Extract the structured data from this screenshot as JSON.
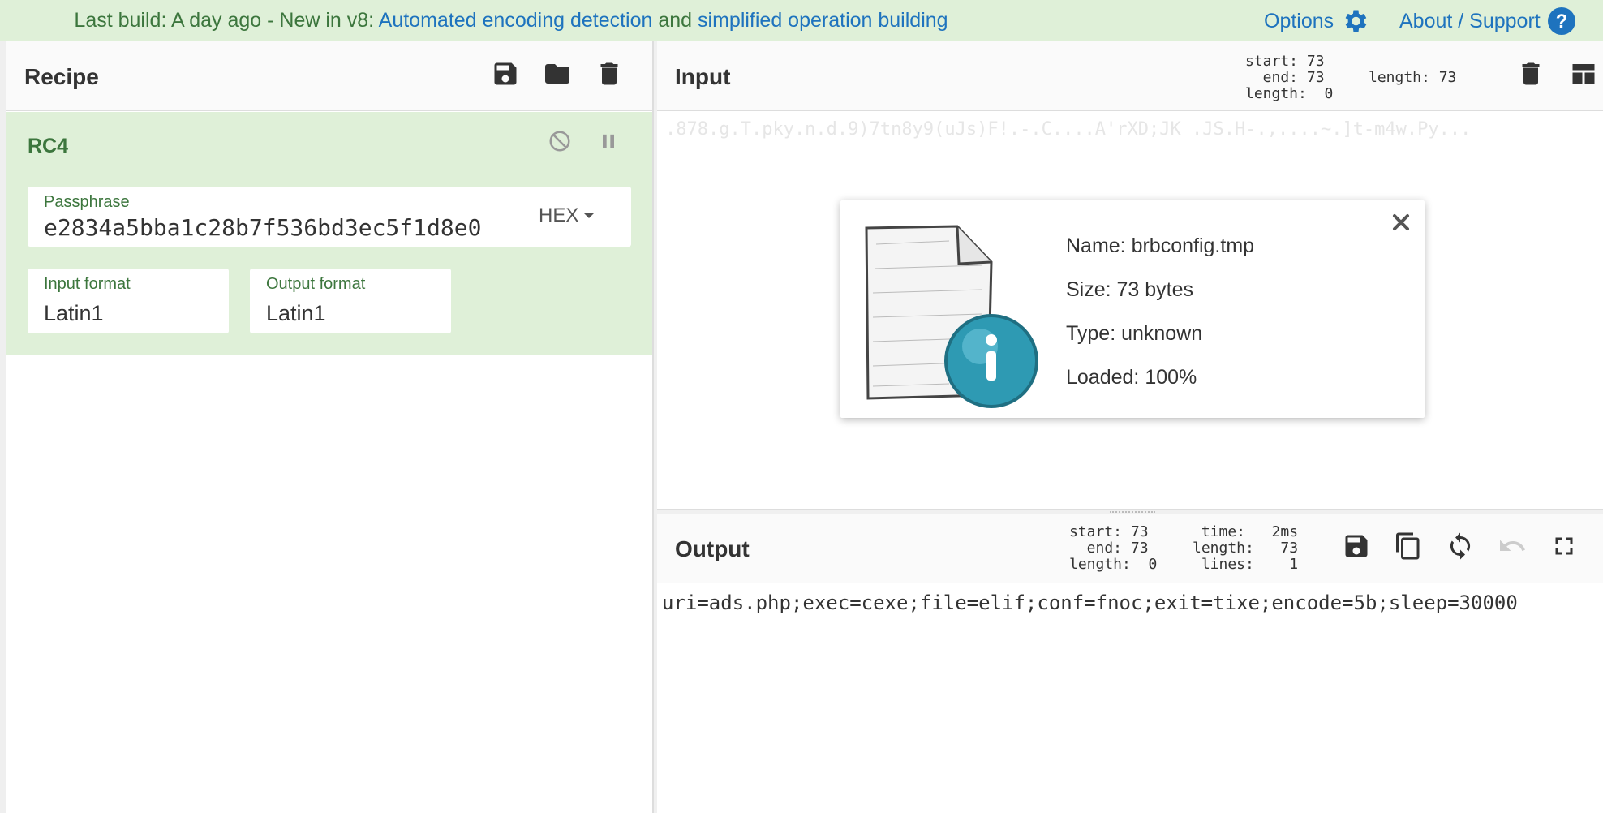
{
  "banner": {
    "prefix": "Last build: A day ago - ",
    "middle": "New in v8: ",
    "link1": "Automated encoding detection",
    "and": " and ",
    "link2": "simplified operation building"
  },
  "top_nav": {
    "options_label": "Options",
    "about_label": "About / Support"
  },
  "recipe": {
    "title": "Recipe",
    "operation": {
      "name": "RC4",
      "passphrase_label": "Passphrase",
      "passphrase_value": "e2834a5bba1c28b7f536bd3ec5f1d8e0",
      "passphrase_format": "HEX",
      "input_format_label": "Input format",
      "input_format_value": "Latin1",
      "output_format_label": "Output format",
      "output_format_value": "Latin1"
    }
  },
  "input": {
    "title": "Input",
    "stats": "start: 73\n  end: 73\nlength:  0",
    "length_stat": "length: 73",
    "preview_text": ".878.g.T.pky.n.d.9)7tn8y9(uJs)F!.-.C....A'rXD;JK .JS.H-.,....~.]t-m4w.Py...",
    "file": {
      "name_label": "Name: brbconfig.tmp",
      "size_label": "Size: 73 bytes",
      "type_label": "Type: unknown",
      "loaded_label": "Loaded: 100%"
    }
  },
  "output": {
    "title": "Output",
    "stats_left": "start: 73\n  end: 73\nlength:  0",
    "stats_right": " time:   2ms\nlength:   73\n lines:    1",
    "text": "uri=ads.php;exec=cexe;file=elif;conf=fnoc;exit=tixe;encode=5b;sleep=30000"
  },
  "colors": {
    "accent_blue": "#1e73be",
    "accent_green": "#3c763d",
    "recipe_bg": "#dff0d8"
  }
}
